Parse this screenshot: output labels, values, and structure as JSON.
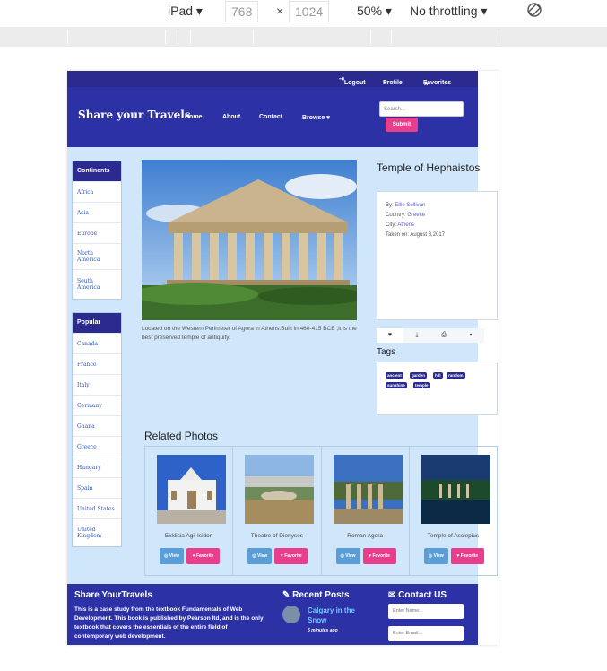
{
  "devtools": {
    "device": "iPad",
    "width": "768",
    "height": "1024",
    "times": "×",
    "zoom": "50%",
    "throttle": "No throttling"
  },
  "topbar": {
    "logout": "Logout",
    "profile": "Profile",
    "favorites": "Favorites"
  },
  "navbar": {
    "brand": "Share your Travels",
    "links": [
      "Home",
      "About",
      "Contact",
      "Browse"
    ],
    "search_placeholder": "Search...",
    "submit": "Submit"
  },
  "sidebar": {
    "continents_title": "Continents",
    "continents": [
      "Africa",
      "Asia",
      "Europe",
      "North America",
      "South America"
    ],
    "popular_title": "Popular",
    "popular": [
      "Canada",
      "France",
      "Italy",
      "Germany",
      "Ghana",
      "Greece",
      "Hungary",
      "Spain",
      "United States",
      "United Kingdom"
    ]
  },
  "photo": {
    "title": "Temple of Hephaistos",
    "caption": "Located on the Western Perimeter of Agora in Athens.Built in 460-415 BCE ,it is the best preserved temple of antiquity.",
    "by_label": "By:",
    "by": "Ellie Sullivan",
    "country_label": "Country:",
    "country": "Greece",
    "city_label": "City:",
    "city": "Athens",
    "taken_label": "Taken on:",
    "taken": "August 8,2017"
  },
  "tags": {
    "title": "Tags",
    "items": [
      "ancient",
      "garden",
      "hill",
      "random",
      "sunshine",
      "temple"
    ]
  },
  "related": {
    "title": "Related Photos",
    "items": [
      {
        "caption": "Ekklisia Agii Isidori"
      },
      {
        "caption": "Theatre of Dionysos"
      },
      {
        "caption": "Roman Agora"
      },
      {
        "caption": "Temple of Asclepius"
      }
    ],
    "view_label": "View",
    "favorite_label": "Favorite"
  },
  "footer": {
    "about_title": "Share YourTravels",
    "about_text": "This is a case study from the textbook Fundamentals of Web Development. This book is published by Pearson ltd, and is the only textbook that covers the essentials of the entire field of contemporary web development.",
    "posts_title": "Recent Posts",
    "post_title": "Calgary in the Snow",
    "post_time": "5 minutes ago",
    "contact_title": "Contact US",
    "name_placeholder": "Enter Name...",
    "email_placeholder": "Enter Email..."
  }
}
